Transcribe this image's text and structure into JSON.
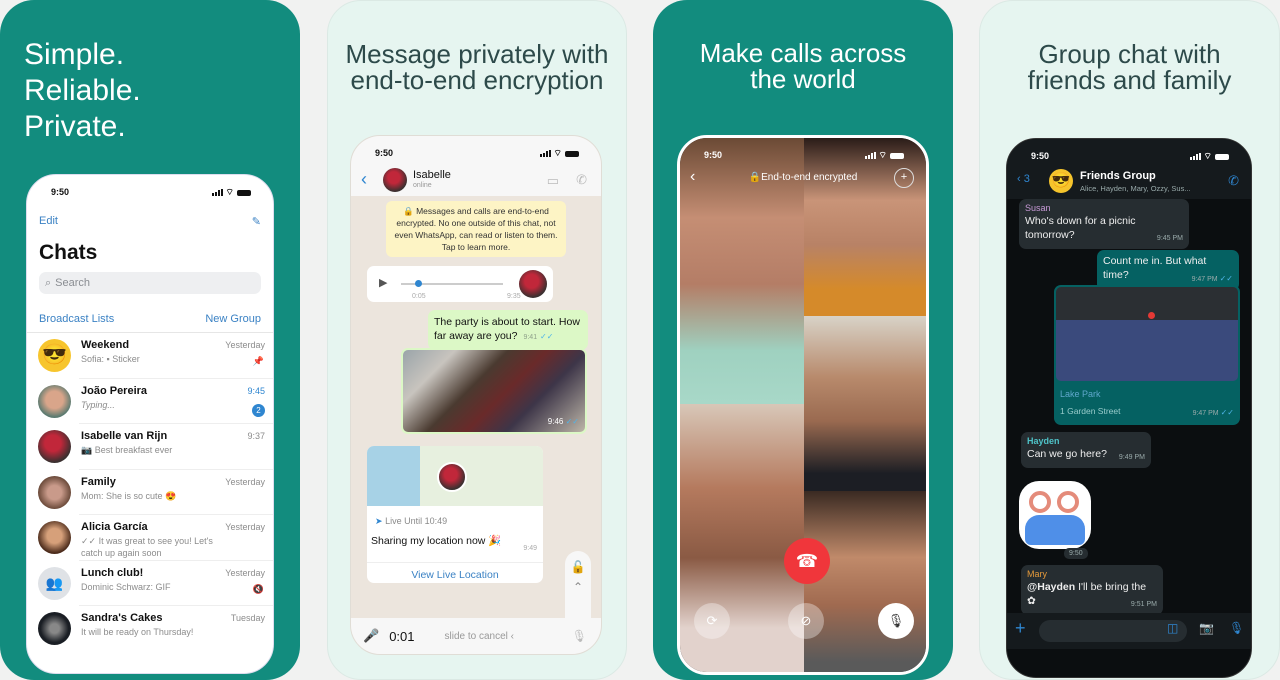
{
  "panels": [
    {
      "headline": [
        "Simple.",
        "Reliable.",
        "Private."
      ]
    },
    {
      "headline": [
        "Message privately with",
        "end-to-end encryption"
      ]
    },
    {
      "headline": [
        "Make calls across",
        "the world"
      ]
    },
    {
      "headline": [
        "Group chat with",
        "friends and family"
      ]
    }
  ],
  "status_time": "9:50",
  "chats_screen": {
    "edit": "Edit",
    "compose_icon": "compose-icon",
    "title": "Chats",
    "search_placeholder": "Search",
    "broadcast": "Broadcast Lists",
    "new_group": "New Group",
    "chats": [
      {
        "name": "Weekend",
        "preview": "Sofia: ▪ Sticker",
        "when": "Yesterday",
        "trail": "📌"
      },
      {
        "name": "João Pereira",
        "preview": "Typing...",
        "when": "9:45",
        "badge": "2"
      },
      {
        "name": "Isabelle van Rijn",
        "preview": "📷 Best breakfast ever",
        "when": "9:37"
      },
      {
        "name": "Family",
        "preview": "Mom: She is so cute 😍",
        "when": "Yesterday"
      },
      {
        "name": "Alicia García",
        "preview": "✓✓ It was great to see you! Let's catch up again soon",
        "when": "Yesterday"
      },
      {
        "name": "Lunch club!",
        "preview": "Dominic Schwarz: GIF",
        "when": "Yesterday",
        "trail": "🔇"
      },
      {
        "name": "Sandra's Cakes",
        "preview": "It will be ready on Thursday!",
        "when": "Tuesday"
      }
    ]
  },
  "private_chat": {
    "contact": "Isabelle",
    "status": "online",
    "encryption_notice": "🔒 Messages and calls are end-to-end encrypted. No one outside of this chat, not even WhatsApp, can read or listen to them. Tap to learn more.",
    "voice_note": {
      "elapsed": "0:05",
      "time": "9:35"
    },
    "message": {
      "text": "The party is about to start. How far away are you?",
      "time": "9:41"
    },
    "photo_time": "9:46",
    "location": {
      "live_until": "Live Until 10:49",
      "text": "Sharing my location now 🎉",
      "time": "9:49",
      "action": "View Live Location"
    },
    "recording": {
      "duration": "0:01",
      "hint": "slide to cancel ‹"
    }
  },
  "call_screen": {
    "label": "End-to-end encrypted"
  },
  "group_chat": {
    "back_count": "3",
    "name": "Friends Group",
    "members": "Alice, Hayden, Mary, Ozzy, Sus...",
    "messages": [
      {
        "sender": "Susan",
        "text": "Who's down for a picnic tomorrow?",
        "time": "9:45 PM"
      },
      {
        "text": "Count me in. But what time?",
        "time": "9:47 PM"
      },
      {
        "place": "Lake Park",
        "address": "1 Garden Street",
        "time": "9:47 PM"
      },
      {
        "sender": "Hayden",
        "text": "Can we go here?",
        "time": "9:49 PM"
      },
      {
        "sticker_time": "9:50"
      },
      {
        "sender": "Mary",
        "mention": "@Hayden",
        "text": " I'll be bring the ✿",
        "time": "9:51 PM"
      }
    ]
  },
  "colors": {
    "brand": "#128c7e",
    "light_panel": "#e6f5f0",
    "link": "#3b82c4",
    "end_call": "#f0363b"
  }
}
